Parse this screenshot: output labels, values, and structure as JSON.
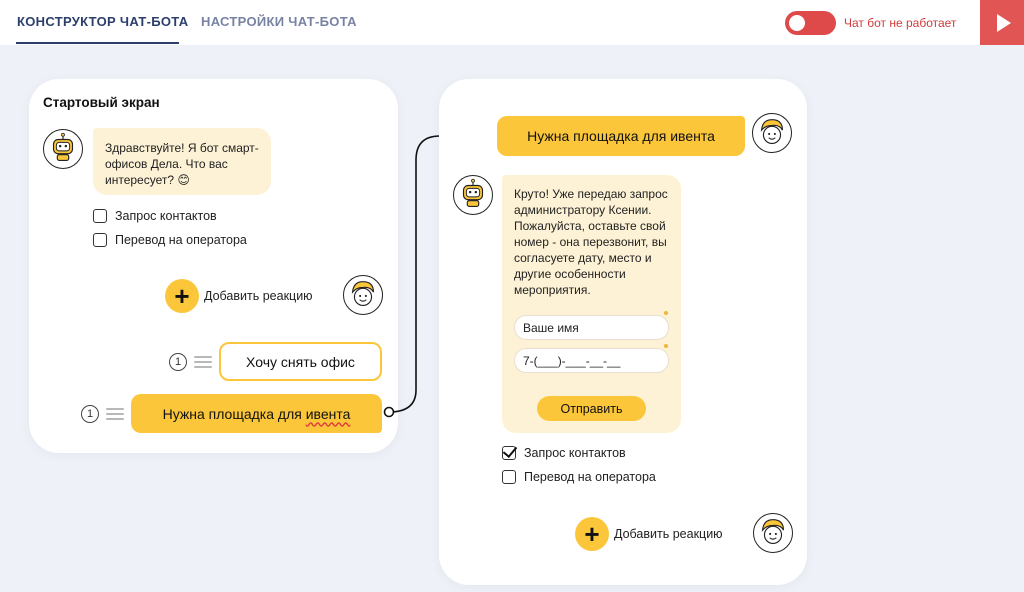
{
  "header": {
    "tabs": [
      {
        "label": "КОНСТРУКТОР ЧАТ-БОТА",
        "active": true
      },
      {
        "label": "НАСТРОЙКИ ЧАТ-БОТА",
        "active": false
      }
    ],
    "bot_status": "Чат бот не работает",
    "toggle_on": false,
    "accent_color": "#de4a4a"
  },
  "start_card": {
    "title": "Стартовый экран",
    "bot_message": "Здравствуйте! Я бот смарт-офисов Дела. Что вас интересует? 😊",
    "options": [
      {
        "label": "Запрос контактов",
        "checked": false
      },
      {
        "label": "Перевод на оператора",
        "checked": false
      }
    ],
    "add_reaction": "Добавить реакцию",
    "answers": [
      {
        "number": "1",
        "label": "Хочу снять офис",
        "style": "outline"
      },
      {
        "number": "1",
        "label_prefix": "Нужна площадка для ",
        "label_word": "ивента",
        "style": "filled"
      }
    ]
  },
  "event_card": {
    "user_message": "Нужна площадка для ивента",
    "bot_message": "Круто! Уже передаю запрос администратору Ксении. Пожалуйста, оставьте свой номер - она перезвонит, вы согласуете дату, место и другие особенности мероприятия.",
    "form": {
      "name_placeholder": "Ваше имя",
      "phone_placeholder": "7-(___)-___-__-__",
      "submit_label": "Отправить"
    },
    "options": [
      {
        "label": "Запрос контактов",
        "checked": true
      },
      {
        "label": "Перевод на оператора",
        "checked": false
      }
    ],
    "add_reaction": "Добавить реакцию"
  },
  "colors": {
    "brand_yellow": "#fcc63b",
    "bubble_bg": "#fdf2d5",
    "nav_blue": "#2c3e6b"
  }
}
